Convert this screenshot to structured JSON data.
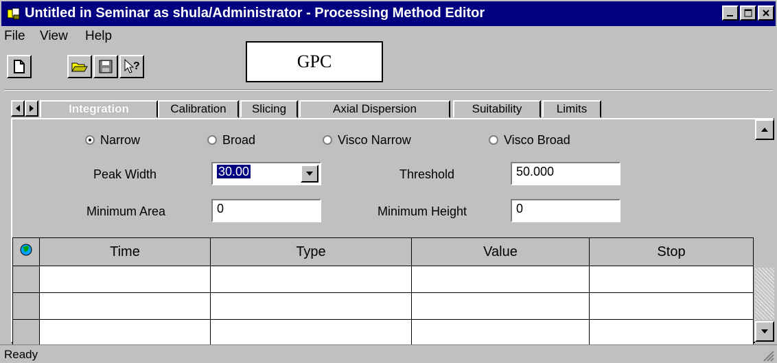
{
  "window": {
    "title": "Untitled in Seminar as shula/Administrator - Processing Method Editor",
    "controls": {
      "minimize": "_",
      "maximize": "☐",
      "close": "✕"
    }
  },
  "menu": [
    {
      "label": "File",
      "underline": "F"
    },
    {
      "label": "View",
      "underline": "V"
    },
    {
      "label": "Help",
      "underline": "H"
    }
  ],
  "toolbar": {
    "icons": [
      "new-document-icon",
      "open-folder-icon",
      "save-disk-icon",
      "context-help-icon"
    ]
  },
  "annotation_box": "GPC",
  "tabs": [
    "Integration",
    "Calibration",
    "Slicing",
    "Axial Dispersion",
    "Suitability",
    "Limits"
  ],
  "active_tab": "Integration",
  "integration": {
    "radios": [
      {
        "label": "Narrow",
        "checked": true
      },
      {
        "label": "Broad",
        "checked": false
      },
      {
        "label": "Visco Narrow",
        "checked": false
      },
      {
        "label": "Visco Broad",
        "checked": false
      }
    ],
    "peak_width_label": "Peak Width",
    "peak_width_value": "30.00",
    "threshold_label": "Threshold",
    "threshold_value": "50.000",
    "min_area_label": "Minimum Area",
    "min_area_value": "0",
    "min_height_label": "Minimum Height",
    "min_height_value": "0"
  },
  "table": {
    "columns": [
      "Time",
      "Type",
      "Value",
      "Stop"
    ],
    "rows": [
      [
        "",
        "",
        "",
        ""
      ],
      [
        "",
        "",
        "",
        ""
      ],
      [
        "",
        "",
        "",
        ""
      ]
    ]
  },
  "status": "Ready",
  "colors": {
    "titlebar": "#000080",
    "face": "#c0c0c0"
  }
}
